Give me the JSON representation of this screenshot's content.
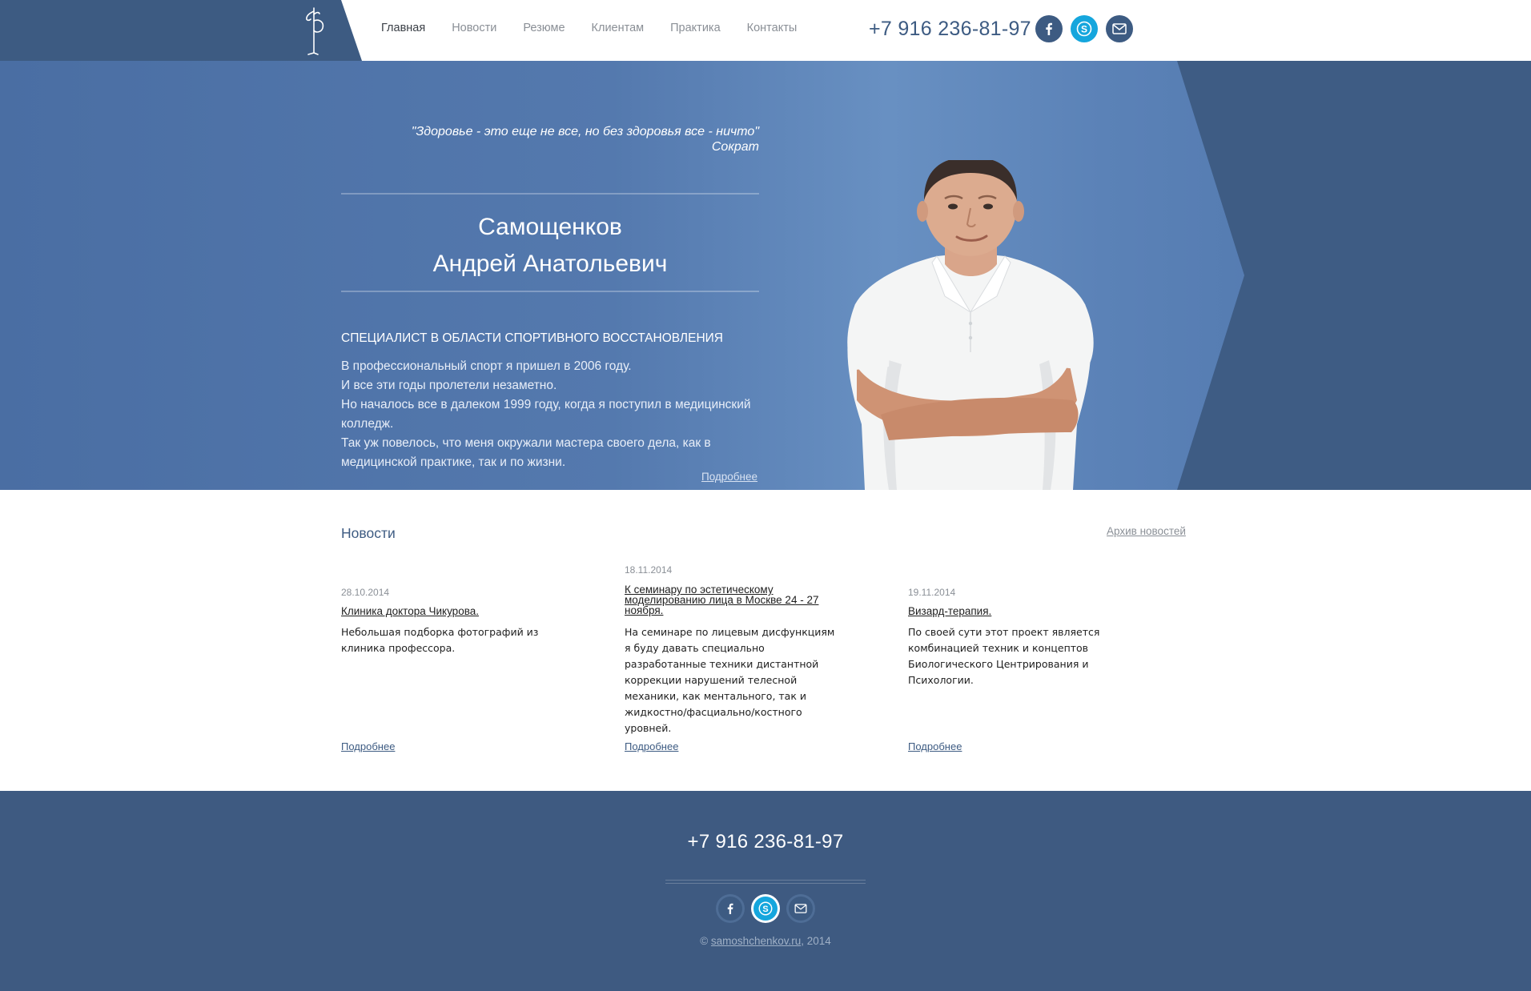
{
  "header": {
    "nav": [
      {
        "label": "Главная",
        "active": true
      },
      {
        "label": "Новости"
      },
      {
        "label": "Резюме"
      },
      {
        "label": "Клиентам"
      },
      {
        "label": "Практика"
      },
      {
        "label": "Контакты"
      }
    ],
    "phone": "+7 916 236-81-97",
    "social": [
      "facebook-icon",
      "skype-icon",
      "mail-icon"
    ]
  },
  "hero": {
    "quote": "\"Здоровье - это еще не все, но без здоровья все - ничто\"",
    "quote_author": "Сократ",
    "surname": "Самощенков",
    "given_name": "Андрей Анатольевич",
    "specialist": "СПЕЦИАЛИСТ В ОБЛАСТИ СПОРТИВНОГО ВОССТАНОВЛЕНИЯ",
    "bio": [
      "В профессиональный спорт я пришел в 2006 году.",
      "И все эти годы пролетели незаметно.",
      "Но началось все в далеком 1999 году, когда я поступил в медицинский колледж.",
      "Так уж повелось, что меня окружали мастера своего дела, как в медицинской практике, так и по жизни."
    ],
    "more": "Подробнее"
  },
  "news": {
    "title": "Новости",
    "archive": "Архив новостей",
    "items": [
      {
        "date": "28.10.2014",
        "title": "Клиника доктора Чикурова.",
        "text": "Небольшая подборка фотографий из клиника профессора.",
        "more": "Подробнее"
      },
      {
        "date": "18.11.2014",
        "title": "К семинару по эстетическому моделированию лица в Москве 24 - 27 ноября.",
        "text": "На семинаре по лицевым дисфункциям я буду давать специально разработанные техники дистантной коррекции нарушений телесной механики, как ментального, так и жидкостно/фасциально/костного уровней.",
        "more": "Подробнее"
      },
      {
        "date": "19.11.2014",
        "title": "Визард-терапия.",
        "text": "По своей сути этот проект является комбинацией техник и концептов Биологического Центрирования и Психологии.",
        "more": "Подробнее"
      }
    ]
  },
  "footer": {
    "phone": "+7 916 236-81-97",
    "copyright_prefix": "©",
    "site": "samoshchenkov.ru",
    "year": ", 2014"
  },
  "colors": {
    "brand": "#3d5b82",
    "skype": "#15a6dd",
    "hero_light": "#6890c2"
  }
}
